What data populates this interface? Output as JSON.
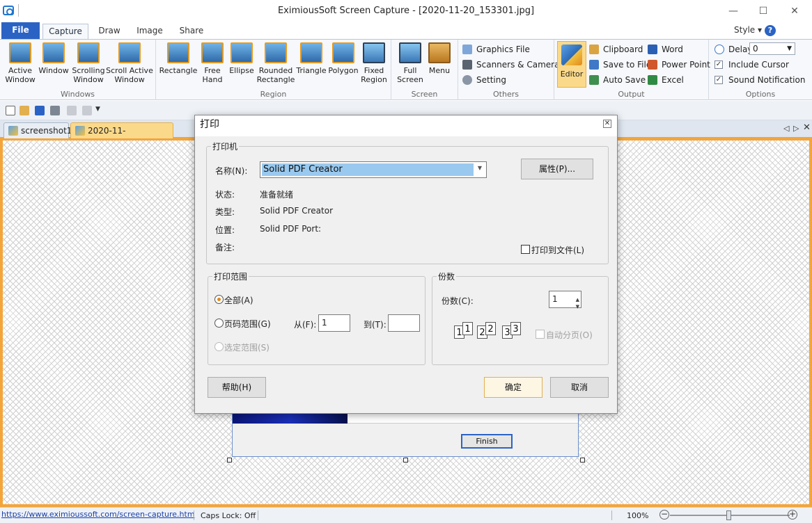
{
  "app": {
    "title": "EximiousSoft Screen Capture - [2020-11-20_153301.jpg]",
    "controls": {
      "minimize": "—",
      "maximize": "☐",
      "close": "✕"
    }
  },
  "ribbon_tabs": {
    "file": "File",
    "tabs": [
      "Capture",
      "Draw",
      "Image",
      "Share"
    ],
    "active": "Capture",
    "style_label": "Style ▾",
    "help": "?"
  },
  "ribbon": {
    "windows": {
      "label": "Windows",
      "buttons": [
        {
          "l1": "Active",
          "l2": "Window"
        },
        {
          "l1": "Window",
          "l2": ""
        },
        {
          "l1": "Scrolling",
          "l2": "Window"
        },
        {
          "l1": "Scroll Active",
          "l2": "Window"
        }
      ]
    },
    "region": {
      "label": "Region",
      "buttons": [
        {
          "l1": "Rectangle",
          "l2": ""
        },
        {
          "l1": "Free",
          "l2": "Hand"
        },
        {
          "l1": "Ellipse",
          "l2": ""
        },
        {
          "l1": "Rounded",
          "l2": "Rectangle"
        },
        {
          "l1": "Triangle",
          "l2": ""
        },
        {
          "l1": "Polygon",
          "l2": ""
        },
        {
          "l1": "Fixed",
          "l2": "Region"
        }
      ]
    },
    "screen": {
      "label": "Screen",
      "buttons": [
        {
          "l1": "Full",
          "l2": "Screen"
        },
        {
          "l1": "Menu",
          "l2": ""
        }
      ]
    },
    "others": {
      "label": "Others",
      "items": [
        "Graphics File",
        "Scanners & Cameras",
        "Setting"
      ]
    },
    "output": {
      "label": "Output",
      "editor": "Editor",
      "items": [
        "Clipboard",
        "Save to File",
        "Auto Save",
        "Word",
        "Power Point",
        "Excel"
      ]
    },
    "options": {
      "label": "Options",
      "delay_label": "Delay",
      "delay_value": "0",
      "include_cursor": "Include Cursor",
      "sound_notification": "Sound Notification",
      "include_cursor_checked": true,
      "sound_notification_checked": true
    }
  },
  "doc_tabs": {
    "tabs": [
      "screenshot1",
      "2020-11-20_153301.jpg"
    ],
    "active_index": 1
  },
  "canvas": {
    "finish_label": "Finish"
  },
  "print_dialog": {
    "title": "打印",
    "printer_group": "打印机",
    "name_label": "名称(N):",
    "name_value": "Solid PDF Creator",
    "properties_btn": "属性(P)...",
    "status_label": "状态:",
    "status_value": "准备就绪",
    "type_label": "类型:",
    "type_value": "Solid PDF Creator",
    "where_label": "位置:",
    "where_value": "Solid PDF Port:",
    "comment_label": "备注:",
    "print_to_file": "打印到文件(L)",
    "range_group": "打印范围",
    "range_all": "全部(A)",
    "range_pages": "页码范围(G)",
    "range_selection": "选定范围(S)",
    "from_label": "从(F):",
    "from_value": "1",
    "to_label": "到(T):",
    "to_value": "",
    "copies_group": "份数",
    "copies_label": "份数(C):",
    "copies_value": "1",
    "collate": "自动分页(O)",
    "collate_pages": [
      "1",
      "1",
      "2",
      "2",
      "3",
      "3"
    ],
    "help_btn": "帮助(H)",
    "ok_btn": "确定",
    "cancel_btn": "取消"
  },
  "status_bar": {
    "link": "https://www.eximioussoft.com/screen-capture.htm",
    "caps_lock": "Caps Lock: Off",
    "zoom": "100%",
    "zoom_minus": "−",
    "zoom_plus": "+",
    "zoom_level_fraction": 0.47
  }
}
